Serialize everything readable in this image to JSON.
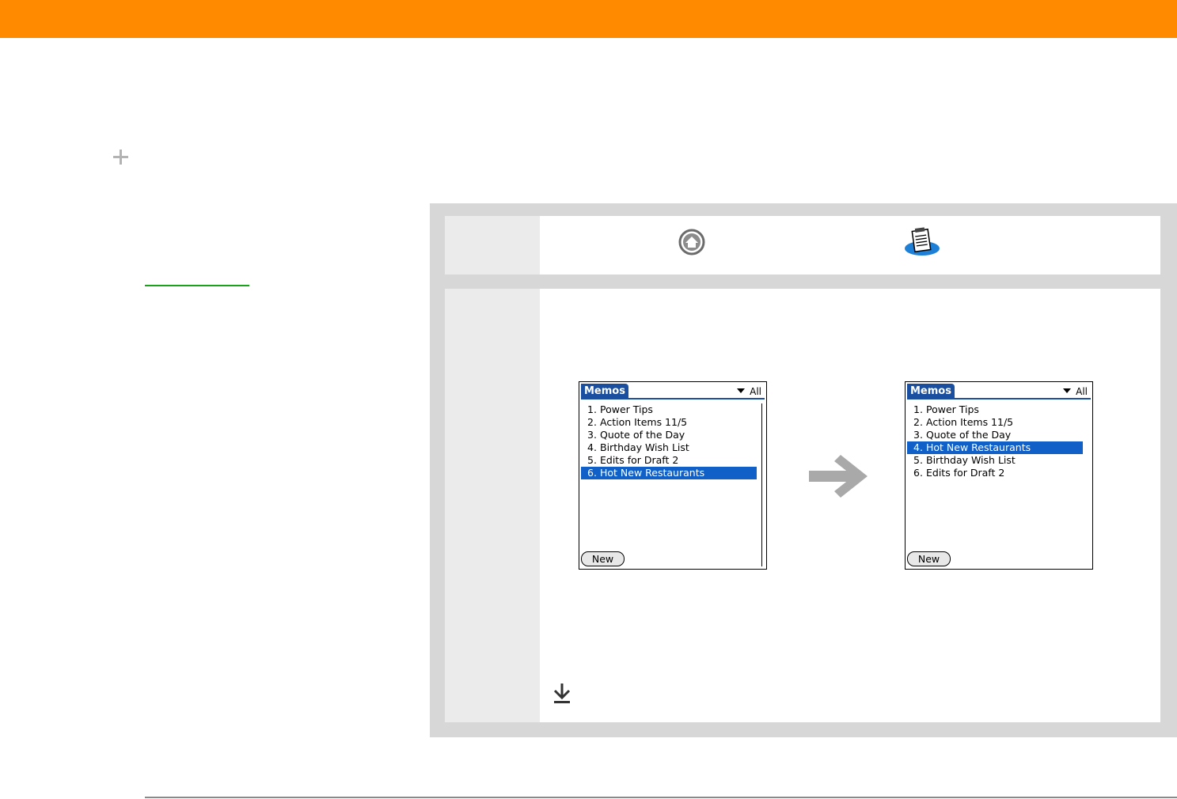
{
  "colors": {
    "top_bar": "#ff8a00",
    "frame": "#d7d7d7",
    "step_num_bg": "#ebebeb",
    "link": "#1aa31a",
    "selection": "#1060c8",
    "tab": "#1a4fa0",
    "arrow": "#a9a9a9"
  },
  "icons": {
    "plus": "plus-icon",
    "home": "home-icon",
    "memos_app": "memos-app-icon",
    "arrow": "arrow-right-icon",
    "down": "download-arrow-icon"
  },
  "screen_before": {
    "tab_label": "Memos",
    "category": "All",
    "items": [
      {
        "num": "1.",
        "label": "Power Tips",
        "selected": false
      },
      {
        "num": "2.",
        "label": "Action Items 11/5",
        "selected": false
      },
      {
        "num": "3.",
        "label": "Quote of the Day",
        "selected": false
      },
      {
        "num": "4.",
        "label": "Birthday Wish List",
        "selected": false
      },
      {
        "num": "5.",
        "label": "Edits for Draft 2",
        "selected": false
      },
      {
        "num": "6.",
        "label": "Hot New Restaurants",
        "selected": true
      }
    ],
    "new_button": "New"
  },
  "screen_after": {
    "tab_label": "Memos",
    "category": "All",
    "items": [
      {
        "num": "1.",
        "label": "Power Tips",
        "selected": false
      },
      {
        "num": "2.",
        "label": "Action Items 11/5",
        "selected": false
      },
      {
        "num": "3.",
        "label": "Quote of the Day",
        "selected": false
      },
      {
        "num": "4.",
        "label": "Hot New Restaurants",
        "selected": true
      },
      {
        "num": "5.",
        "label": "Birthday Wish List",
        "selected": false
      },
      {
        "num": "6.",
        "label": "Edits for Draft 2",
        "selected": false
      }
    ],
    "new_button": "New"
  }
}
